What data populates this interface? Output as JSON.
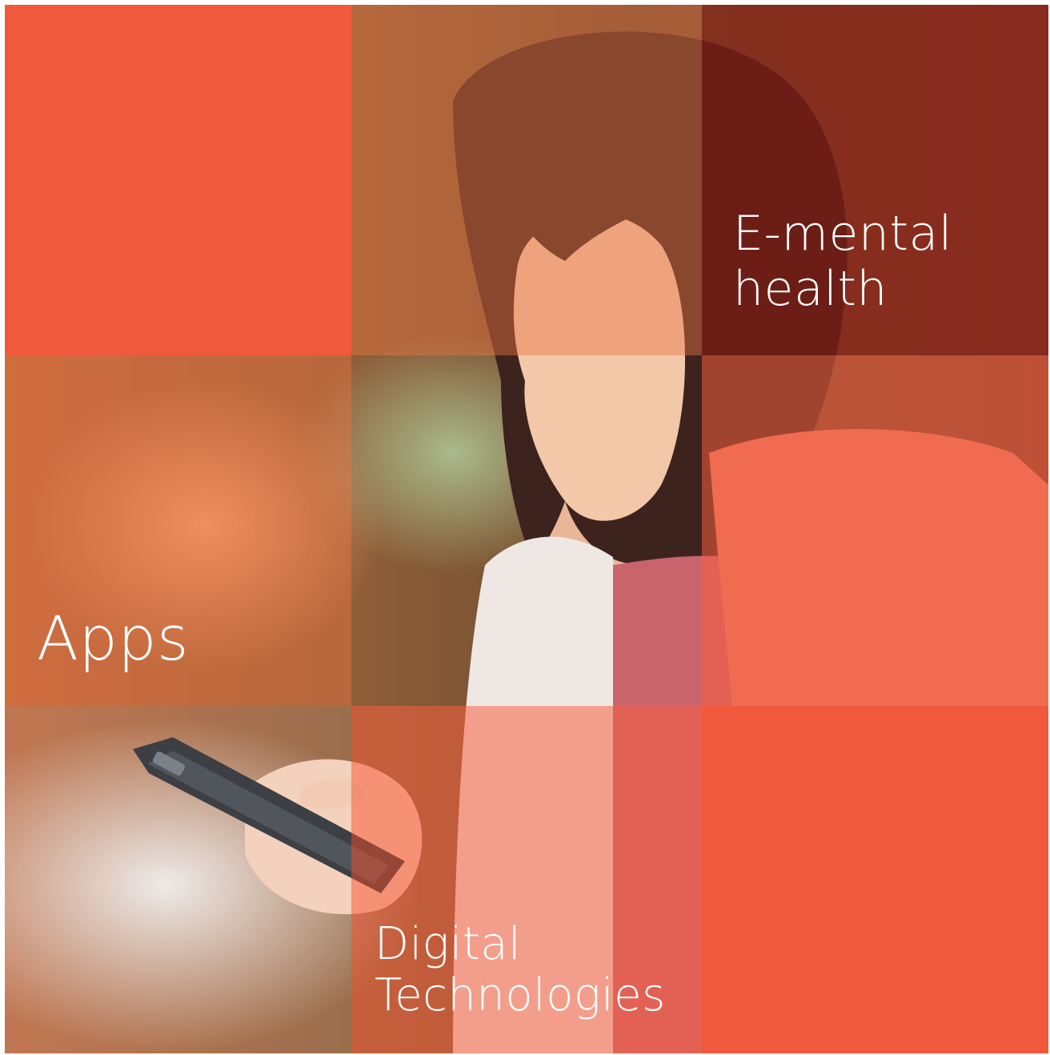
{
  "labels": {
    "apps": "Apps",
    "e_mental_line1": "E-mental",
    "e_mental_line2": "health",
    "digital_line1": "Digital",
    "digital_line2": "Technologies"
  },
  "colors": {
    "accent": "#f0593c",
    "text": "#ffffff"
  }
}
